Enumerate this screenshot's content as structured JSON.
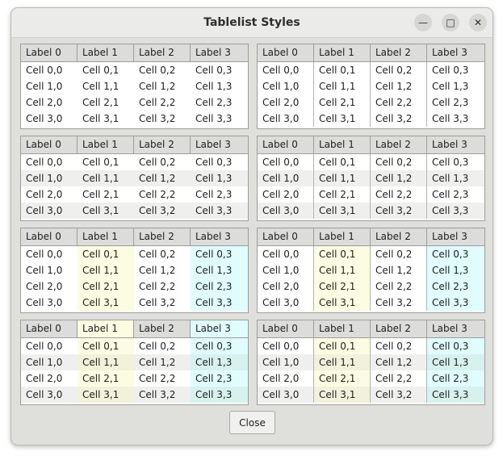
{
  "window": {
    "title": "Tablelist Styles",
    "minimize_glyph": "—",
    "maximize_glyph": "□",
    "close_glyph": "✕"
  },
  "tables": {
    "headers": [
      "Label 0",
      "Label 1",
      "Label 2",
      "Label 3"
    ],
    "rows": [
      [
        "Cell 0,0",
        "Cell 0,1",
        "Cell 0,2",
        "Cell 0,3"
      ],
      [
        "Cell 1,0",
        "Cell 1,1",
        "Cell 1,2",
        "Cell 1,3"
      ],
      [
        "Cell 2,0",
        "Cell 2,1",
        "Cell 2,2",
        "Cell 2,3"
      ],
      [
        "Cell 3,0",
        "Cell 3,1",
        "Cell 3,2",
        "Cell 3,3"
      ]
    ],
    "colors": {
      "plain": "#ffffff",
      "stripe": "#efefed",
      "yellow": "#fcfce2",
      "yellow_stripe": "#f1f1dc",
      "cyan": "#e0fcfc",
      "cyan_stripe": "#d7f1ef",
      "header_bg": "#dcdcda",
      "selected_header_col1": "#fcfce2",
      "selected_header_col3": "#e0fcfc"
    },
    "variants": [
      {
        "stripes": false,
        "col_colors": false,
        "header_colors": false,
        "col_sep": false
      },
      {
        "stripes": false,
        "col_colors": false,
        "header_colors": false,
        "col_sep": true
      },
      {
        "stripes": true,
        "col_colors": false,
        "header_colors": false,
        "col_sep": false
      },
      {
        "stripes": true,
        "col_colors": false,
        "header_colors": false,
        "col_sep": true
      },
      {
        "stripes": false,
        "col_colors": true,
        "header_colors": false,
        "col_sep": false
      },
      {
        "stripes": false,
        "col_colors": true,
        "header_colors": false,
        "col_sep": true
      },
      {
        "stripes": true,
        "col_colors": true,
        "header_colors": true,
        "col_sep": false
      },
      {
        "stripes": true,
        "col_colors": true,
        "header_colors": false,
        "col_sep": true
      }
    ]
  },
  "close_button": {
    "label": "Close"
  }
}
